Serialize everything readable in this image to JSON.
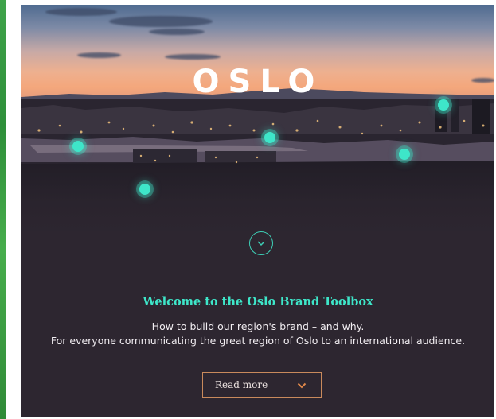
{
  "hero": {
    "logo_text": "OSLO"
  },
  "content": {
    "headline": "Welcome to the Oslo Brand Toolbox",
    "subtitle_line1": "How to build our region's brand – and why.",
    "subtitle_line2": "For everyone communicating the great region of Oslo to an international audience."
  },
  "cta": {
    "read_more_label": "Read more"
  },
  "icons": {
    "scroll_down": "chevron-down-icon",
    "read_more": "chevron-down-icon",
    "pins": "map-pin-icon"
  },
  "colors": {
    "accent_teal": "#3ee6c9",
    "background": "#2d2630",
    "button_border": "#c98a5c",
    "side_strip": "#3fa34a"
  }
}
